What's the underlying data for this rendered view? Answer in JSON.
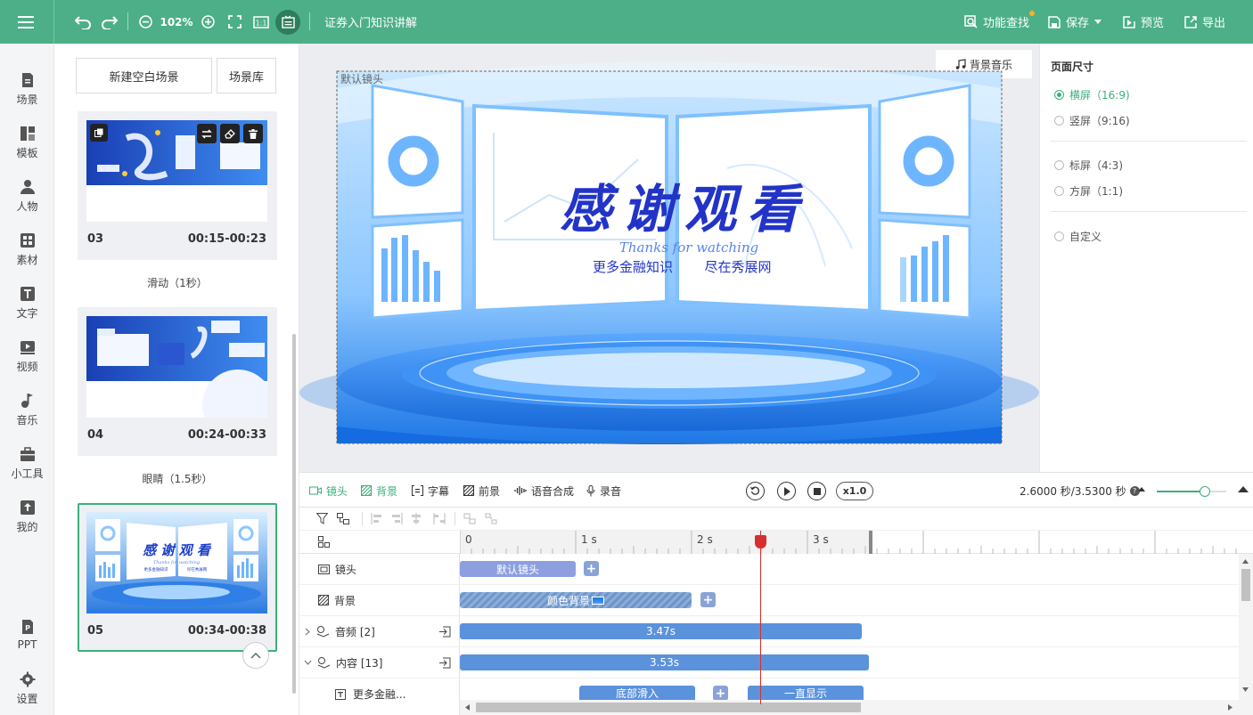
{
  "topbar": {
    "zoom": "102%",
    "doc_title": "证券入门知识讲解",
    "feature_search": "功能查找",
    "save": "保存",
    "preview": "预览",
    "export": "导出"
  },
  "sidebar": {
    "items": [
      {
        "label": "场景",
        "icon": "scene-icon"
      },
      {
        "label": "模板",
        "icon": "template-icon"
      },
      {
        "label": "人物",
        "icon": "person-icon"
      },
      {
        "label": "素材",
        "icon": "material-icon"
      },
      {
        "label": "文字",
        "icon": "text-icon"
      },
      {
        "label": "视频",
        "icon": "video-icon"
      },
      {
        "label": "音乐",
        "icon": "music-icon"
      },
      {
        "label": "小工具",
        "icon": "toolbox-icon"
      },
      {
        "label": "我的",
        "icon": "upload-icon"
      },
      {
        "label": "PPT",
        "icon": "ppt-icon"
      },
      {
        "label": "设置",
        "icon": "gear-icon"
      }
    ]
  },
  "scenes": {
    "new_blank": "新建空白场景",
    "library": "场景库",
    "cards": [
      {
        "num": "03",
        "time": "00:15-00:23"
      },
      {
        "num": "04",
        "time": "00:24-00:33"
      },
      {
        "num": "05",
        "time": "00:34-00:38"
      }
    ],
    "transitions": [
      "滑动（1秒）",
      "眼睛（1.5秒）"
    ]
  },
  "canvas": {
    "default_shot_label": "默认镜头",
    "bg_music": "背景音乐",
    "slide_title": "感谢观看",
    "slide_subtitle": "Thanks for watching",
    "slide_line1": "更多金融知识",
    "slide_line2": "尽在秀展网",
    "thumb_title": "感 谢 观 看"
  },
  "props": {
    "title": "页面尺寸",
    "options": [
      {
        "label": "横屏（16:9)",
        "selected": true
      },
      {
        "label": "竖屏（9:16)",
        "selected": false
      },
      {
        "label": "标屏（4:3)",
        "selected": false
      },
      {
        "label": "方屏（1:1)",
        "selected": false
      },
      {
        "label": "自定义",
        "selected": false
      }
    ]
  },
  "timeline": {
    "tabs": [
      "镜头",
      "背景",
      "字幕",
      "前景",
      "语音合成",
      "录音"
    ],
    "active_tab": "背景",
    "speed": "x1.0",
    "time_readout": "2.6000 秒/3.5300 秒",
    "ruler_labels": [
      "0",
      "1 s",
      "2 s",
      "3 s"
    ],
    "tracks": [
      {
        "label": "镜头"
      },
      {
        "label": "背景"
      },
      {
        "label": "音频 [2]"
      },
      {
        "label": "内容 [13]"
      },
      {
        "label": "更多金融..."
      }
    ],
    "clips": {
      "shot": "默认镜头",
      "bg": "颜色背景",
      "audio": "3.47s",
      "content": "3.53s",
      "sub_a": "底部滑入",
      "sub_b": "一直显示"
    }
  }
}
